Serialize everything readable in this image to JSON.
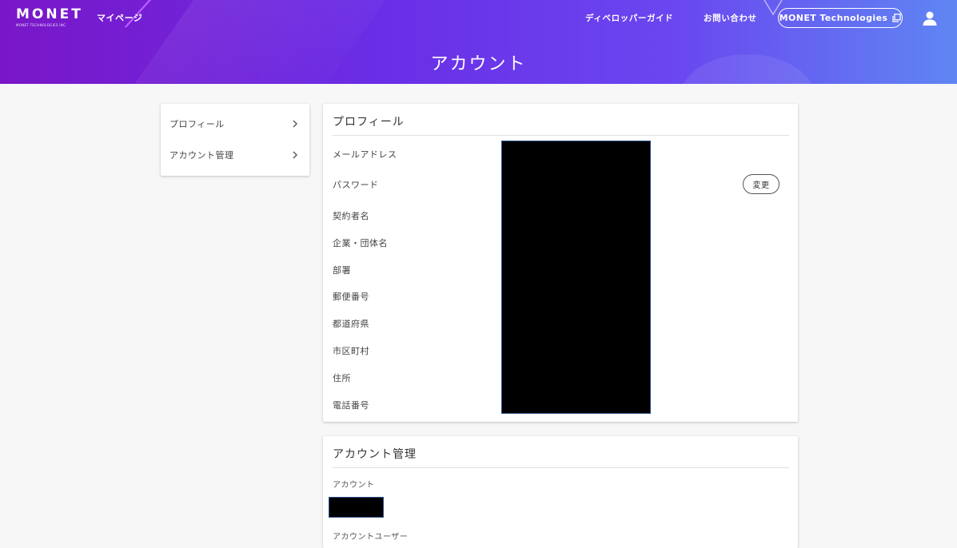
{
  "header": {
    "logo": {
      "wordmark": "MONET",
      "subtitle": "MONET TECHNOLOGIES INC."
    },
    "nav_mypage": "マイページ",
    "nav_developer_guide": "ディベロッパーガイド",
    "nav_contact": "お問い合わせ",
    "external_button": "MONET Technologies",
    "page_title": "アカウント",
    "colors": {
      "gradient_start": "#7a16c8",
      "gradient_mid": "#6a46f0",
      "gradient_end": "#5f86f2"
    }
  },
  "sidebar": {
    "items": [
      {
        "label": "プロフィール"
      },
      {
        "label": "アカウント管理"
      }
    ]
  },
  "profile": {
    "title": "プロフィール",
    "fields": [
      {
        "label": "メールアドレス"
      },
      {
        "label": "パスワード"
      },
      {
        "label": "契約者名"
      },
      {
        "label": "企業・団体名"
      },
      {
        "label": "部署"
      },
      {
        "label": "郵便番号"
      },
      {
        "label": "都道府県"
      },
      {
        "label": "市区町村"
      },
      {
        "label": "住所"
      },
      {
        "label": "電話番号"
      }
    ],
    "change_button": "変更"
  },
  "account": {
    "title": "アカウント管理",
    "account_label": "アカウント",
    "account_user_label": "アカウントユーザー"
  }
}
